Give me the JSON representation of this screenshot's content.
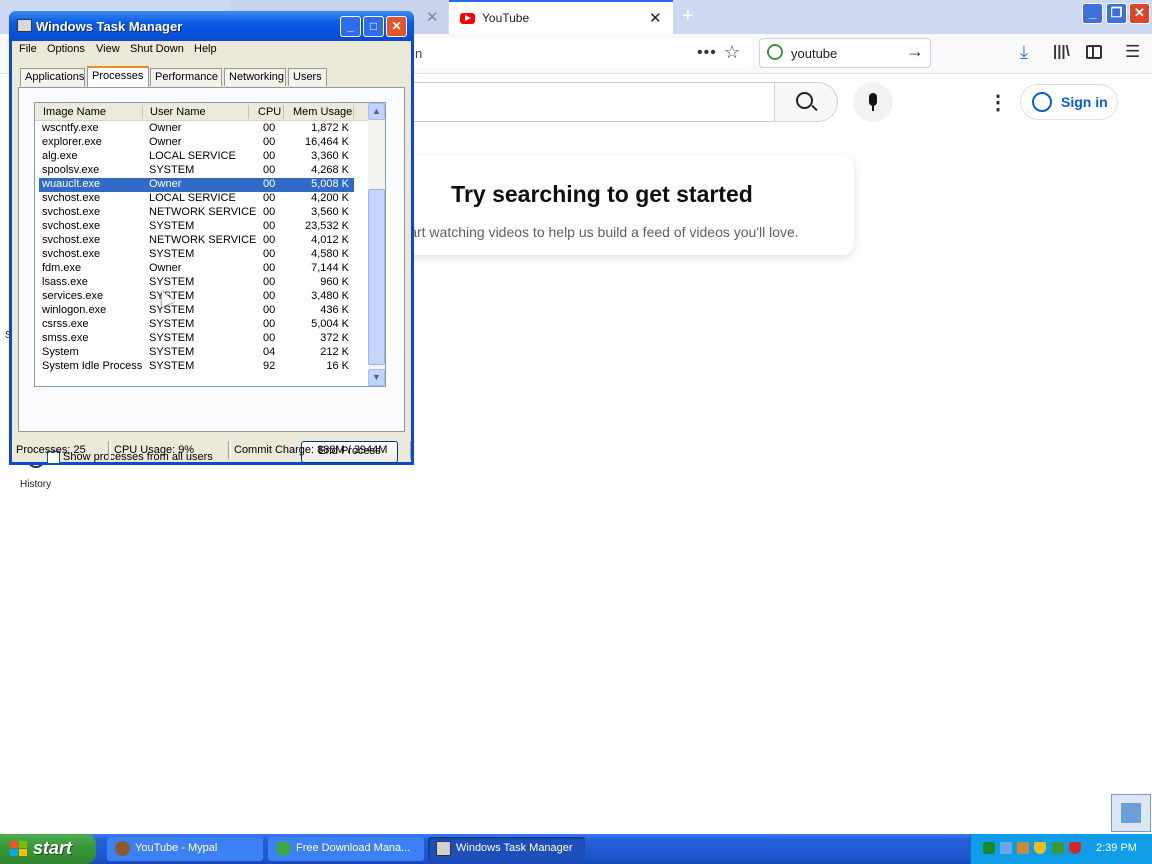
{
  "browser": {
    "tabs": [
      {
        "label": "YouTube",
        "active": true
      }
    ],
    "url_fragment": "n",
    "page_actions_glyph": "•••",
    "search_bar_value": "youtube"
  },
  "youtube": {
    "sign_in_label": "Sign in",
    "card_title": "Try searching to get started",
    "card_subtitle": "tart watching videos to help us build a feed of videos you'll love.",
    "sidebar_history_label": "History",
    "sidebar_partial_label": "S"
  },
  "taskmgr": {
    "title": "Windows Task Manager",
    "menu": [
      "File",
      "Options",
      "View",
      "Shut Down",
      "Help"
    ],
    "tabs": [
      "Applications",
      "Processes",
      "Performance",
      "Networking",
      "Users"
    ],
    "active_tab": "Processes",
    "columns": [
      "Image Name",
      "User Name",
      "CPU",
      "Mem Usage"
    ],
    "processes": [
      {
        "name": "wscntfy.exe",
        "user": "Owner",
        "cpu": "00",
        "mem": "1,872 K"
      },
      {
        "name": "explorer.exe",
        "user": "Owner",
        "cpu": "00",
        "mem": "16,464 K"
      },
      {
        "name": "alg.exe",
        "user": "LOCAL SERVICE",
        "cpu": "00",
        "mem": "3,360 K"
      },
      {
        "name": "spoolsv.exe",
        "user": "SYSTEM",
        "cpu": "00",
        "mem": "4,268 K"
      },
      {
        "name": "wuauclt.exe",
        "user": "Owner",
        "cpu": "00",
        "mem": "5,008 K",
        "selected": true
      },
      {
        "name": "svchost.exe",
        "user": "LOCAL SERVICE",
        "cpu": "00",
        "mem": "4,200 K"
      },
      {
        "name": "svchost.exe",
        "user": "NETWORK SERVICE",
        "cpu": "00",
        "mem": "3,560 K"
      },
      {
        "name": "svchost.exe",
        "user": "SYSTEM",
        "cpu": "00",
        "mem": "23,532 K"
      },
      {
        "name": "svchost.exe",
        "user": "NETWORK SERVICE",
        "cpu": "00",
        "mem": "4,012 K"
      },
      {
        "name": "svchost.exe",
        "user": "SYSTEM",
        "cpu": "00",
        "mem": "4,580 K"
      },
      {
        "name": "fdm.exe",
        "user": "Owner",
        "cpu": "00",
        "mem": "7,144 K"
      },
      {
        "name": "lsass.exe",
        "user": "SYSTEM",
        "cpu": "00",
        "mem": "960 K"
      },
      {
        "name": "services.exe",
        "user": "SYSTEM",
        "cpu": "00",
        "mem": "3,480 K"
      },
      {
        "name": "winlogon.exe",
        "user": "SYSTEM",
        "cpu": "00",
        "mem": "436 K"
      },
      {
        "name": "csrss.exe",
        "user": "SYSTEM",
        "cpu": "00",
        "mem": "5,004 K"
      },
      {
        "name": "smss.exe",
        "user": "SYSTEM",
        "cpu": "00",
        "mem": "372 K"
      },
      {
        "name": "System",
        "user": "SYSTEM",
        "cpu": "04",
        "mem": "212 K"
      },
      {
        "name": "System Idle Process",
        "user": "SYSTEM",
        "cpu": "92",
        "mem": "16 K"
      }
    ],
    "show_all_label": "Show processes from all users",
    "show_all_checked": false,
    "end_process_label": "End Process",
    "status": {
      "processes": "Processes: 25",
      "cpu": "CPU Usage: 9%",
      "commit": "Commit Charge: 888M / 3944M"
    }
  },
  "taskbar": {
    "start_label": "start",
    "tasks": [
      {
        "label": "YouTube - Mypal",
        "active": false
      },
      {
        "label": "Free Download Mana...",
        "active": false
      },
      {
        "label": "Windows Task Manager",
        "active": true
      }
    ],
    "clock": "2:39 PM"
  },
  "colors": {
    "xp_blue": "#245edb",
    "selection": "#316ac5",
    "youtube_red": "#ff0000",
    "youtube_link": "#065fd4"
  }
}
